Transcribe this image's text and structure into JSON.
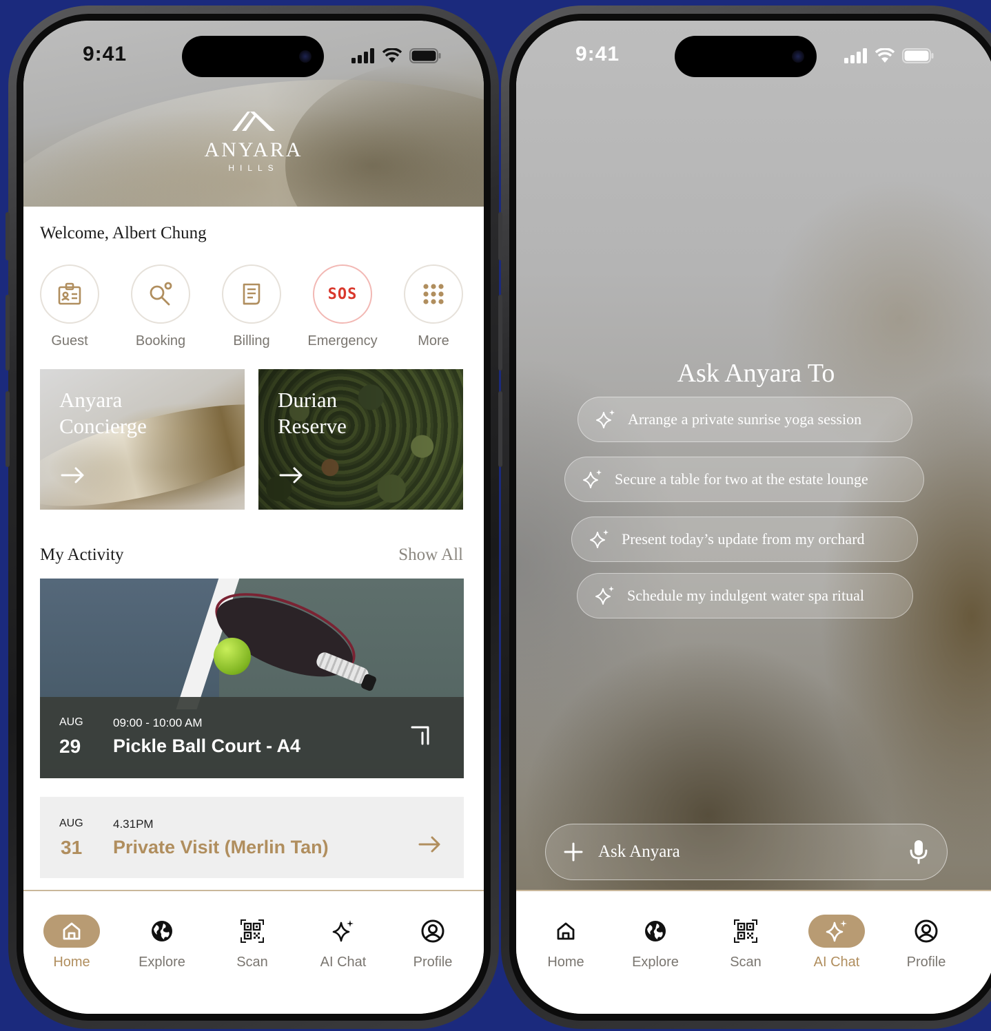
{
  "left_phone": {
    "status_time": "9:41",
    "brand": {
      "name": "ANYARA",
      "subtitle": "HILLS"
    },
    "welcome": "Welcome, Albert Chung",
    "quick_actions": [
      {
        "label": "Guest",
        "icon": "guest-card-icon"
      },
      {
        "label": "Booking",
        "icon": "booking-search-icon"
      },
      {
        "label": "Billing",
        "icon": "receipt-icon"
      },
      {
        "label": "Emergency",
        "icon": "sos-icon",
        "badge": "SOS"
      },
      {
        "label": "More",
        "icon": "grid-dots-icon"
      }
    ],
    "features": [
      {
        "title_line1": "Anyara",
        "title_line2": "Concierge"
      },
      {
        "title_line1": "Durian",
        "title_line2": "Reserve"
      }
    ],
    "activity": {
      "title": "My Activity",
      "show_all": "Show All",
      "items": [
        {
          "month": "AUG",
          "day": "29",
          "time": "09:00 - 10:00 AM",
          "title": "Pickle Ball Court - A4"
        },
        {
          "month": "AUG",
          "day": "31",
          "time": "4.31PM",
          "title": "Private Visit (Merlin Tan)"
        }
      ]
    },
    "tabs": [
      "Home",
      "Explore",
      "Scan",
      "AI Chat",
      "Profile"
    ],
    "active_tab": "Home"
  },
  "right_phone": {
    "status_time": "9:41",
    "title": "Ask Anyara To",
    "suggestions": [
      "Arrange a private sunrise yoga session",
      "Secure a table for two at the estate lounge",
      "Present today’s update from my orchard",
      "Schedule my indulgent water spa ritual"
    ],
    "input_placeholder": "Ask Anyara",
    "tabs": [
      "Home",
      "Explore",
      "Scan",
      "AI Chat",
      "Profile"
    ],
    "active_tab": "AI Chat"
  },
  "colors": {
    "background": "#1b2a7d",
    "accent_gold": "#b89b73",
    "accent_text": "#b08e5e",
    "sos_red": "#d9382c"
  }
}
